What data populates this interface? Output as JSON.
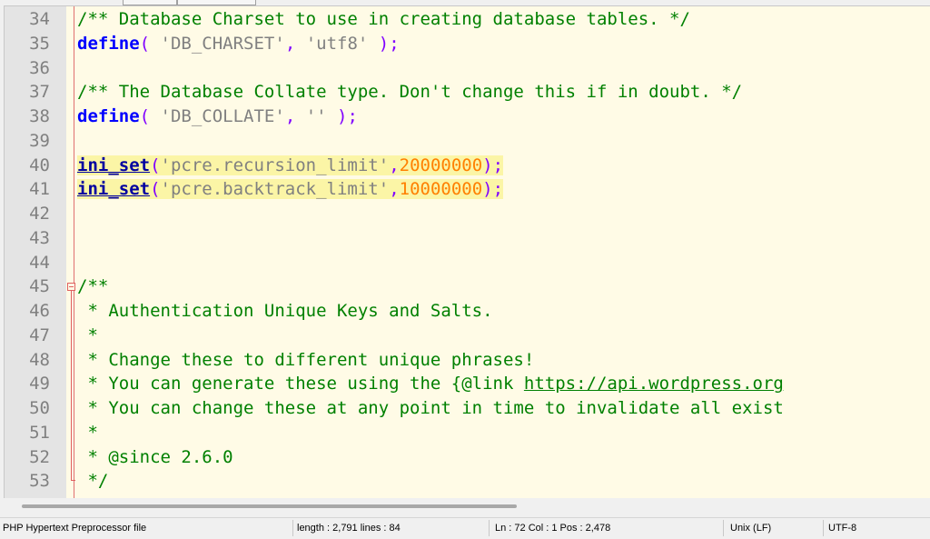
{
  "editor": {
    "lines": [
      {
        "num": "34",
        "tokens": [
          {
            "t": "/** Database Charset to use in creating database tables. */",
            "c": "cmt"
          }
        ]
      },
      {
        "num": "35",
        "tokens": [
          {
            "t": "define",
            "c": "kw"
          },
          {
            "t": "( ",
            "c": "op"
          },
          {
            "t": "'DB_CHARSET'",
            "c": "str"
          },
          {
            "t": ", ",
            "c": "op"
          },
          {
            "t": "'utf8'",
            "c": "str"
          },
          {
            "t": " );",
            "c": "op"
          }
        ]
      },
      {
        "num": "36",
        "tokens": []
      },
      {
        "num": "37",
        "tokens": [
          {
            "t": "/** The Database Collate type. Don't change this if in doubt. */",
            "c": "cmt"
          }
        ]
      },
      {
        "num": "38",
        "tokens": [
          {
            "t": "define",
            "c": "kw"
          },
          {
            "t": "( ",
            "c": "op"
          },
          {
            "t": "'DB_COLLATE'",
            "c": "str"
          },
          {
            "t": ", ",
            "c": "op"
          },
          {
            "t": "''",
            "c": "str"
          },
          {
            "t": " );",
            "c": "op"
          }
        ]
      },
      {
        "num": "39",
        "tokens": []
      },
      {
        "num": "40",
        "hl": true,
        "tokens": [
          {
            "t": "ini_set",
            "c": "fn"
          },
          {
            "t": "(",
            "c": "op"
          },
          {
            "t": "'pcre.recursion_limit'",
            "c": "str"
          },
          {
            "t": ",",
            "c": "op"
          },
          {
            "t": "20000000",
            "c": "num"
          },
          {
            "t": ");",
            "c": "op"
          }
        ]
      },
      {
        "num": "41",
        "hl": true,
        "tokens": [
          {
            "t": "ini_set",
            "c": "fn"
          },
          {
            "t": "(",
            "c": "op"
          },
          {
            "t": "'pcre.backtrack_limit'",
            "c": "str"
          },
          {
            "t": ",",
            "c": "op"
          },
          {
            "t": "10000000",
            "c": "num"
          },
          {
            "t": ");",
            "c": "op"
          }
        ]
      },
      {
        "num": "42",
        "tokens": []
      },
      {
        "num": "43",
        "tokens": []
      },
      {
        "num": "44",
        "tokens": []
      },
      {
        "num": "45",
        "tokens": [
          {
            "t": "/**",
            "c": "cmt"
          }
        ]
      },
      {
        "num": "46",
        "tokens": [
          {
            "t": " * Authentication Unique Keys and Salts.",
            "c": "cmt"
          }
        ]
      },
      {
        "num": "47",
        "tokens": [
          {
            "t": " *",
            "c": "cmt"
          }
        ]
      },
      {
        "num": "48",
        "tokens": [
          {
            "t": " * Change these to different unique phrases!",
            "c": "cmt"
          }
        ]
      },
      {
        "num": "49",
        "tokens": [
          {
            "t": " * You can generate these using the {@link ",
            "c": "cmt"
          },
          {
            "t": "https://api.wordpress.org",
            "c": "link"
          }
        ]
      },
      {
        "num": "50",
        "tokens": [
          {
            "t": " * You can change these at any point in time to invalidate all exist",
            "c": "cmt"
          }
        ]
      },
      {
        "num": "51",
        "tokens": [
          {
            "t": " *",
            "c": "cmt"
          }
        ]
      },
      {
        "num": "52",
        "tokens": [
          {
            "t": " * @since 2.6.0",
            "c": "cmt"
          }
        ]
      },
      {
        "num": "53",
        "tokens": [
          {
            "t": " */",
            "c": "cmt"
          }
        ]
      }
    ]
  },
  "statusbar": {
    "file_type": "PHP Hypertext Preprocessor file",
    "length_lines": "length : 2,791    lines : 84",
    "position": "Ln : 72    Col : 1    Pos : 2,478",
    "eol": "Unix (LF)",
    "encoding": "UTF-8"
  }
}
